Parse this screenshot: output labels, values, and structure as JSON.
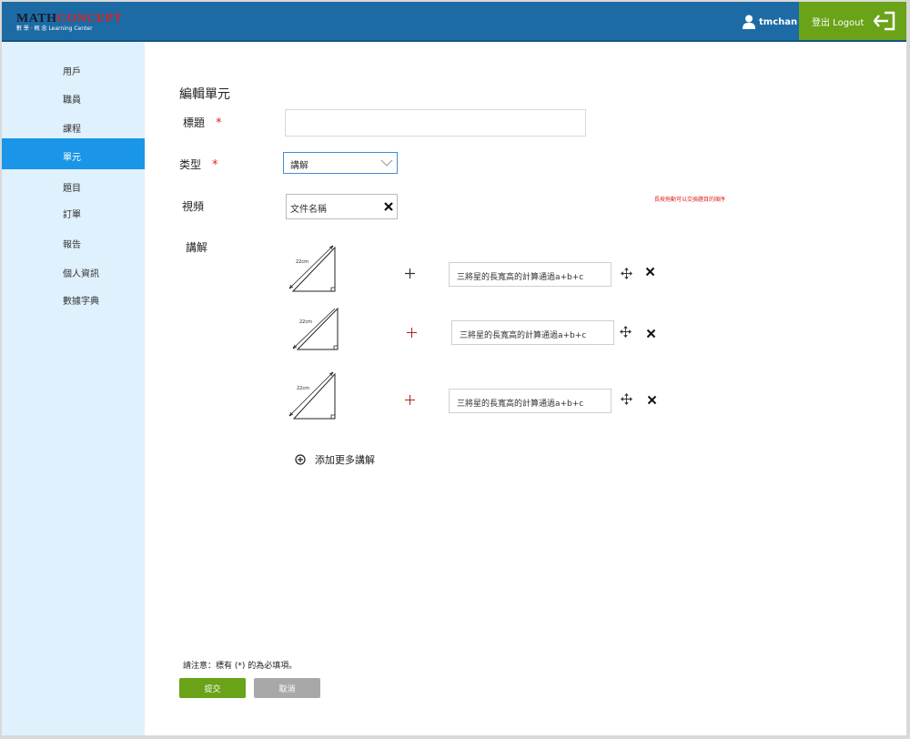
{
  "header": {
    "logo_main_a": "MATH",
    "logo_main_b": "CONCEPT",
    "logo_sub": "數 學 · 概 念  Learning Center",
    "username": "tmchan",
    "logout_label": "登出 Logout",
    "bg_color": "#1d6ba5",
    "logout_color": "#6aa318"
  },
  "sidebar": {
    "items": [
      {
        "label": "用戶"
      },
      {
        "label": "職員"
      },
      {
        "label": "課程"
      },
      {
        "label": "單元",
        "active": true
      },
      {
        "label": "題目"
      },
      {
        "label": "訂單"
      },
      {
        "label": "報告"
      },
      {
        "label": "個人資訊"
      },
      {
        "label": "數據字典"
      }
    ],
    "active_color": "#1b95e8",
    "bg_color": "#dff1fd"
  },
  "form": {
    "page_title": "編輯單元",
    "title_label": "標題",
    "title_value": "",
    "required_mark": "*",
    "type_label": "类型",
    "type_value": "講解",
    "video_label": "視頻",
    "video_file": "文件名稱",
    "explanation_label": "講解",
    "drag_hint": "長按拖動可以交換題目的順序",
    "triangle_caption": "22cm",
    "explanations": [
      {
        "text": "三將星的長寬高的計算通過a+b+c"
      },
      {
        "text": "三將星的長寬高的計算通過a+b+c"
      },
      {
        "text": "三將星的長寬高的計算通過a+b+c"
      }
    ],
    "add_more_label": "添加更多講解",
    "note": "請注意：標有 (*) 的為必填項。",
    "submit_label": "提交",
    "cancel_label": "取消"
  }
}
